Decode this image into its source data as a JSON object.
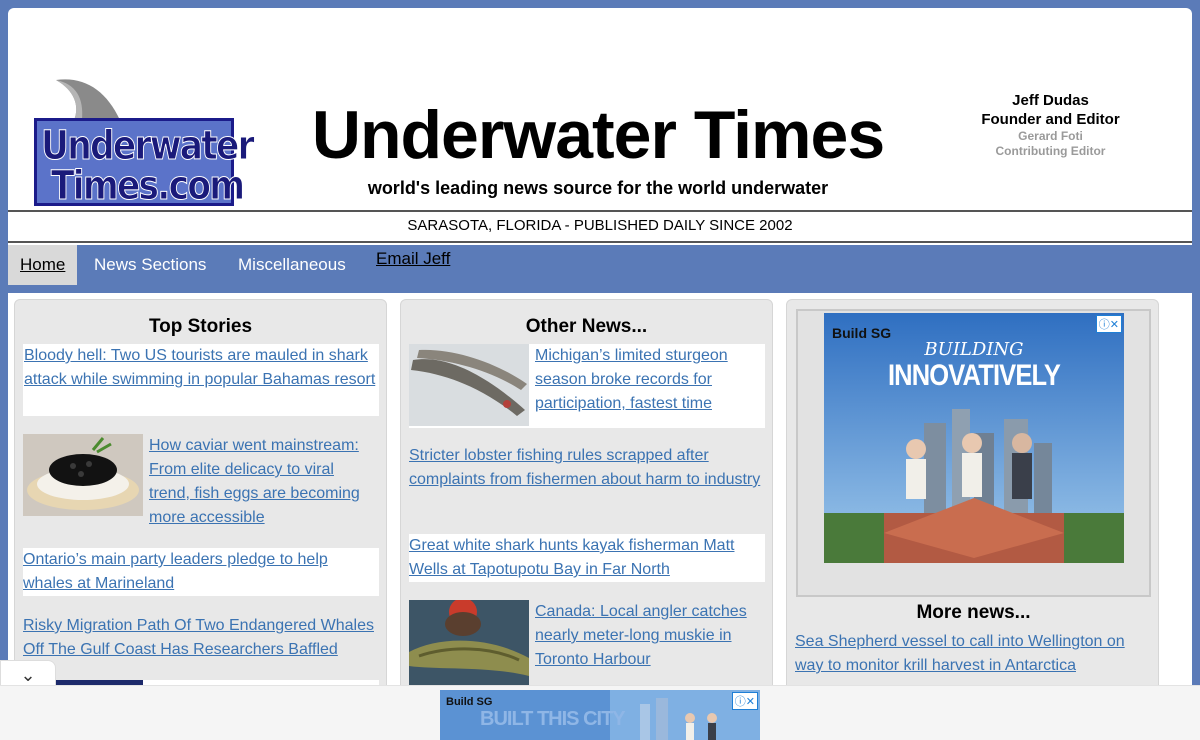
{
  "header": {
    "logo_line1": "Underwater",
    "logo_line2": "Times.com",
    "title": "Underwater Times",
    "tagline": "world's leading news source for the world underwater",
    "editor_name": "Jeff Dudas",
    "editor_role": "Founder and Editor",
    "contrib_name": "Gerard Foti",
    "contrib_role": "Contributing Editor",
    "dateline": "SARASOTA, FLORIDA - PUBLISHED DAILY SINCE 2002"
  },
  "nav": {
    "home": "Home",
    "sections": "News Sections",
    "misc": "Miscellaneous",
    "email": "Email Jeff"
  },
  "top_stories": {
    "heading": "Top Stories",
    "items": [
      "Bloody hell: Two US tourists are mauled in shark attack while swimming in popular Bahamas resort",
      "How caviar went mainstream: From elite delicacy to viral trend, fish eggs are becoming more accessible",
      "Ontario’s main party leaders pledge to help whales at Marineland",
      "Risky Migration Path Of Two Endangered Whales Off The Gulf Coast Has Researchers Baffled"
    ]
  },
  "other_news": {
    "heading": "Other News...",
    "items": [
      "Michigan’s limited sturgeon season broke records for participation, fastest time",
      "Stricter lobster fishing rules scrapped after complaints from fishermen about harm to industry",
      "Great white shark hunts kayak fisherman Matt Wells at Tapotupotu Bay in Far North",
      "Canada: Local angler catches nearly meter-long muskie in Toronto Harbour"
    ]
  },
  "ad": {
    "brand": "Build SG",
    "line1": "BUILDING",
    "line2": "INNOVATIVELY",
    "bottom_brand": "Build SG",
    "bottom_text": "BUILT THIS CITY"
  },
  "more_news": {
    "heading": "More news...",
    "items": [
      "Sea Shepherd vessel to call into Wellington on way to monitor krill harvest in Antarctica"
    ]
  },
  "colors": {
    "frame": "#5b7bb8",
    "link": "#3b73b2",
    "panel": "#e8e8e8"
  }
}
